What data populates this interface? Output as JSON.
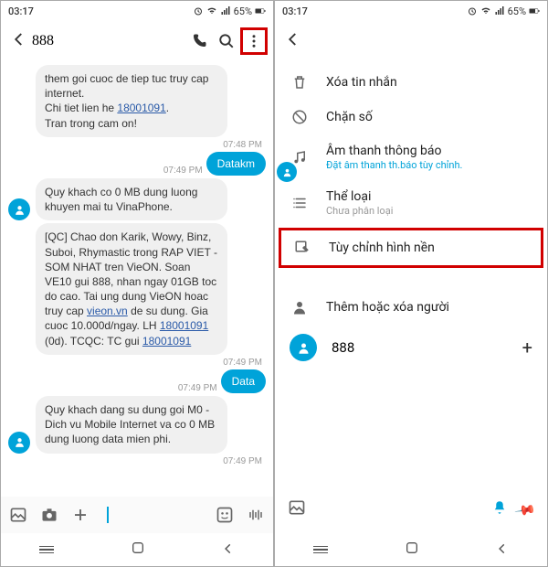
{
  "status": {
    "time": "03:17",
    "battery": "65%"
  },
  "left": {
    "title": "888",
    "messages": {
      "m1": "them goi cuoc de tiep tuc truy cap internet.\nChi tiet lien he 18001091.\nTran trong cam on!",
      "t1": "07:48 PM",
      "tcenter": "07:49 PM",
      "out1": "Datakm",
      "m2": "Quy khach co 0 MB dung luong khuyen mai tu VinaPhone.",
      "m3": "[QC] Chao don Karik, Wowy, Binz, Suboi, Rhymastic trong RAP VIET - SOM NHAT tren VieON. Soan VE10 gui 888, nhan ngay 01GB toc do cao. Tai ung dung VieON hoac truy cap vieon.vn de su dung. Gia cuoc 10.000d/ngay. LH 18001091 (0d). TCQC: TC gui 18001091",
      "t3": "07:49 PM",
      "out2": "Data",
      "t4": "07:49 PM",
      "m4": "Quy khach dang su dung goi M0 - Dich vu Mobile Internet va co 0 MB dung luong data mien phi.",
      "t5": "07:49 PM"
    }
  },
  "right": {
    "menu": {
      "delete": "Xóa tin nhắn",
      "block": "Chặn số",
      "sound": "Âm thanh thông báo",
      "sound_sub": "Đặt âm thanh th.báo tùy chỉnh.",
      "category": "Thể loại",
      "category_sub": "Chưa phân loại",
      "wallpaper": "Tùy chỉnh hình nền",
      "people": "Thêm hoặc xóa người",
      "contact": "888"
    }
  }
}
